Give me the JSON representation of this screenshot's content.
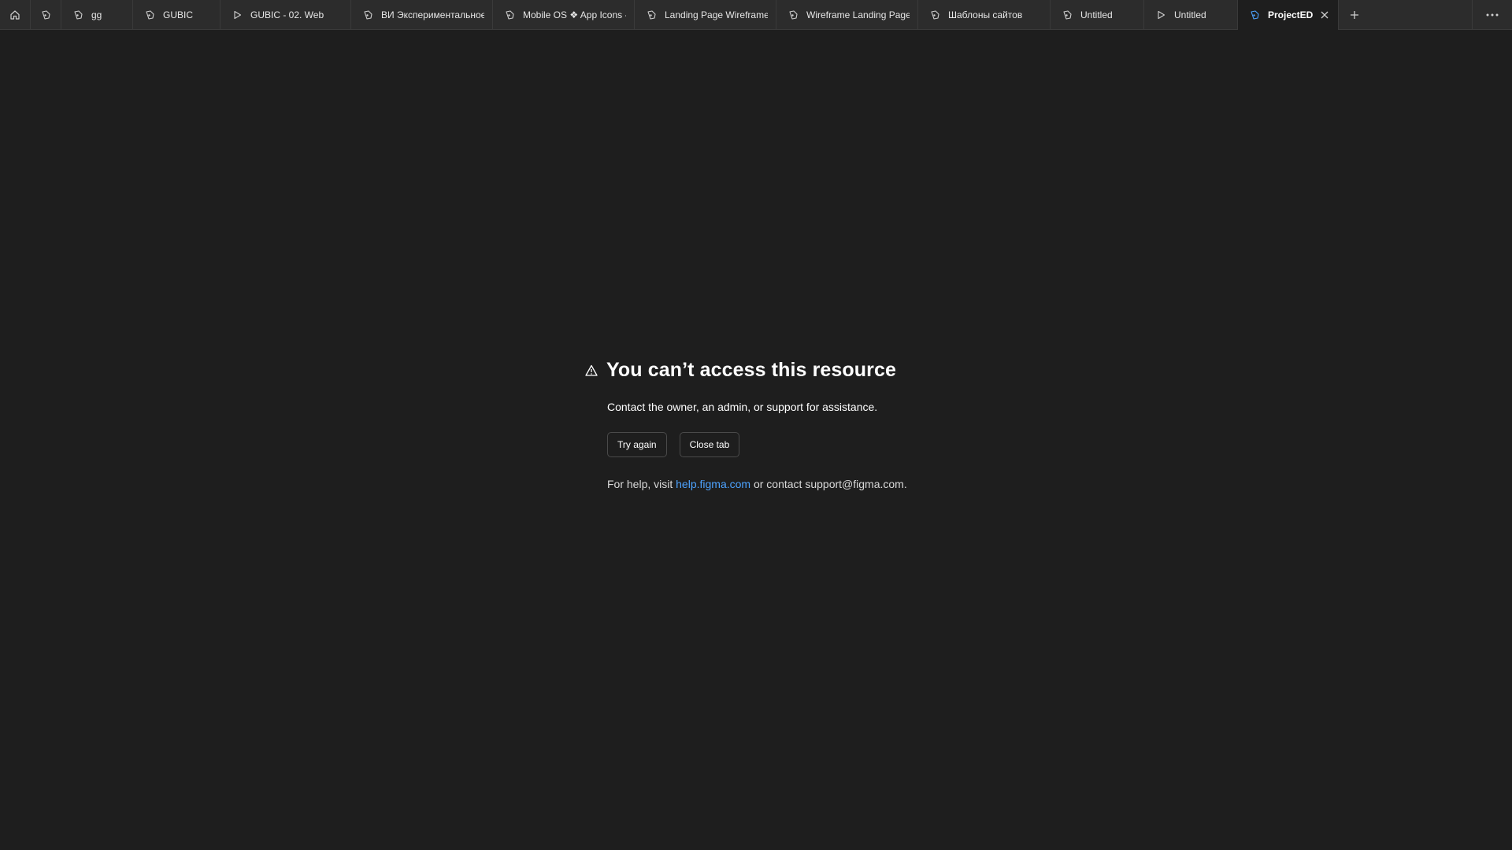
{
  "tabbar": {
    "tabs": [
      {
        "label": "gg",
        "icon": "figma-file-icon"
      },
      {
        "label": "GUBIC",
        "icon": "figma-file-icon"
      },
      {
        "label": "GUBIC - 02. Web",
        "icon": "play-icon"
      },
      {
        "label": "ВИ Экспериментальное",
        "icon": "figma-file-icon"
      },
      {
        "label": "Mobile OS ❖ App Icons -",
        "icon": "figma-file-icon"
      },
      {
        "label": "Landing Page Wireframe",
        "icon": "figma-file-icon"
      },
      {
        "label": "Wireframe Landing Page",
        "icon": "figma-file-icon"
      },
      {
        "label": "Шаблоны сайтов",
        "icon": "figma-file-icon"
      },
      {
        "label": "Untitled",
        "icon": "figma-file-icon"
      },
      {
        "label": "Untitled",
        "icon": "play-icon"
      },
      {
        "label": "ProjectED",
        "icon": "figma-file-icon",
        "active": true
      }
    ]
  },
  "error": {
    "title": "You can’t access this resource",
    "subtitle": "Contact the owner, an admin, or support for assistance.",
    "try_again": "Try again",
    "close_tab": "Close tab",
    "help_prefix": "For help, visit ",
    "help_link": "help.figma.com",
    "help_suffix": " or contact support@figma.com."
  },
  "colors": {
    "background": "#1e1e1e",
    "tabbar": "#2c2c2c",
    "link": "#4da3ff",
    "active_icon": "#4da3ff"
  }
}
